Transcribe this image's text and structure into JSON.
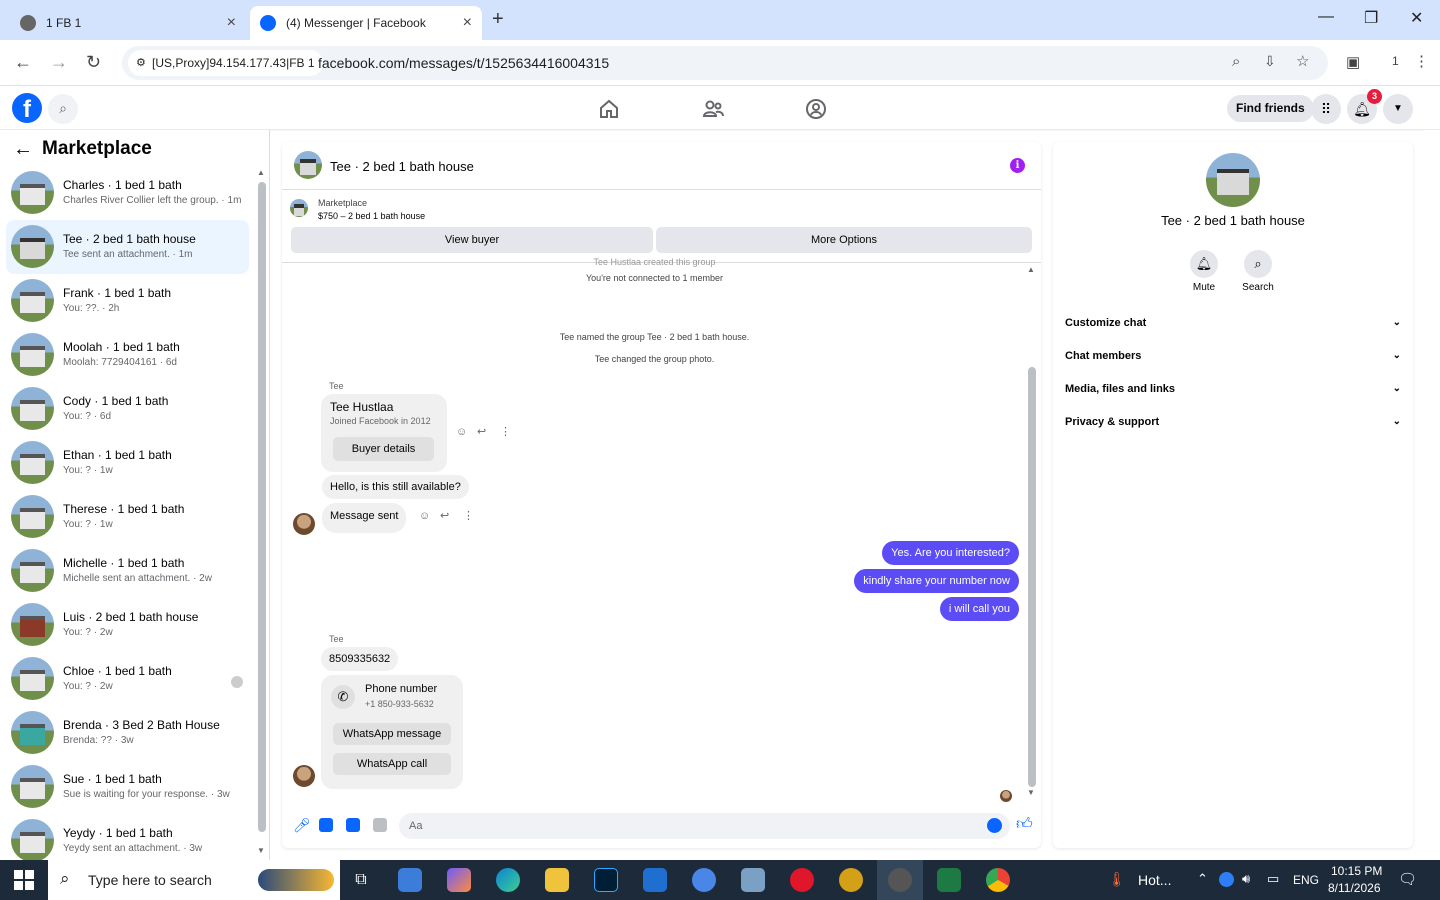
{
  "browser": {
    "tabs": [
      {
        "title": "1 FB 1"
      },
      {
        "title": "(4) Messenger | Facebook"
      }
    ],
    "site_chip": "[US,Proxy]94.154.177.43|FB 1",
    "url": "facebook.com/messages/t/1525634416004315",
    "profile_count": "1"
  },
  "fb_header": {
    "find_friends": "Find friends",
    "notification_count": "3"
  },
  "sidebar": {
    "title": "Marketplace",
    "conversations": [
      {
        "name": "Charles · 1 bed 1 bath",
        "snippet": "Charles River Collier left the group. · 1m",
        "active": false
      },
      {
        "name": "Tee · 2 bed 1 bath house",
        "snippet": "Tee sent an attachment. · 1m",
        "active": true
      },
      {
        "name": "Frank · 1 bed 1 bath",
        "snippet": "You: ??. · 2h",
        "active": false
      },
      {
        "name": "Moolah · 1 bed 1 bath",
        "snippet": "Moolah: 7729404161 · 6d",
        "active": false
      },
      {
        "name": "Cody · 1 bed 1 bath",
        "snippet": "You: ? · 6d",
        "active": false
      },
      {
        "name": "Ethan · 1 bed 1 bath",
        "snippet": "You: ? · 1w",
        "active": false
      },
      {
        "name": "Therese · 1 bed 1 bath",
        "snippet": "You: ? · 1w",
        "active": false
      },
      {
        "name": "Michelle · 1 bed 1 bath",
        "snippet": "Michelle sent an attachment. · 2w",
        "active": false
      },
      {
        "name": "Luis · 2 bed 1 bath house",
        "snippet": "You: ? · 2w",
        "active": false
      },
      {
        "name": "Chloe · 1 bed 1 bath",
        "snippet": "You: ? · 2w",
        "active": false
      },
      {
        "name": "Brenda · 3 Bed 2 Bath House",
        "snippet": "Brenda: ?? · 3w",
        "active": false
      },
      {
        "name": "Sue · 1 bed 1 bath",
        "snippet": "Sue is waiting for your response. · 3w",
        "active": false
      },
      {
        "name": "Yeydy · 1 bed 1 bath",
        "snippet": "Yeydy sent an attachment. · 3w",
        "active": false
      }
    ]
  },
  "chat": {
    "title": "Tee · 2 bed 1 bath house",
    "marketplace_label": "Marketplace",
    "listing": "$750 – 2 bed 1 bath house",
    "view_buyer": "View buyer",
    "more_options": "More Options",
    "system": {
      "created": "Tee Hustlaa created this group",
      "not_connected": "You're not connected to 1 member",
      "named": "Tee named the group Tee · 2 bed 1 bath house.",
      "changed_photo": "Tee changed the group photo."
    },
    "sender_name": "Tee",
    "buyer_card": {
      "name": "Tee Hustlaa",
      "joined": "Joined Facebook in 2012",
      "button": "Buyer details"
    },
    "incoming_1": "Hello, is this still available?",
    "incoming_2": "Message sent",
    "outgoing": [
      "Yes. Are you interested?",
      "kindly share your number now",
      "i will call you"
    ],
    "sender_name_2": "Tee",
    "number_msg": "8509335632",
    "phone_card": {
      "title": "Phone number",
      "number": "+1 850-933-5632",
      "whatsapp_message": "WhatsApp message",
      "whatsapp_call": "WhatsApp call"
    },
    "composer_placeholder": "Aa"
  },
  "details": {
    "name": "Tee · 2 bed 1 bath house",
    "mute": "Mute",
    "search": "Search",
    "sections": [
      "Customize chat",
      "Chat members",
      "Media, files and links",
      "Privacy & support"
    ]
  },
  "taskbar": {
    "search_placeholder": "Type here to search",
    "weather": "Hot...",
    "language": "ENG",
    "time": "10:15 PM",
    "date": "8/11/2026",
    "notification_count": "1"
  },
  "colors": {
    "fb_blue": "#0866ff",
    "outgoing_bubble": "#5b4cf5",
    "active_conv": "#ebf5ff",
    "notif_badge": "#e41e3f"
  }
}
